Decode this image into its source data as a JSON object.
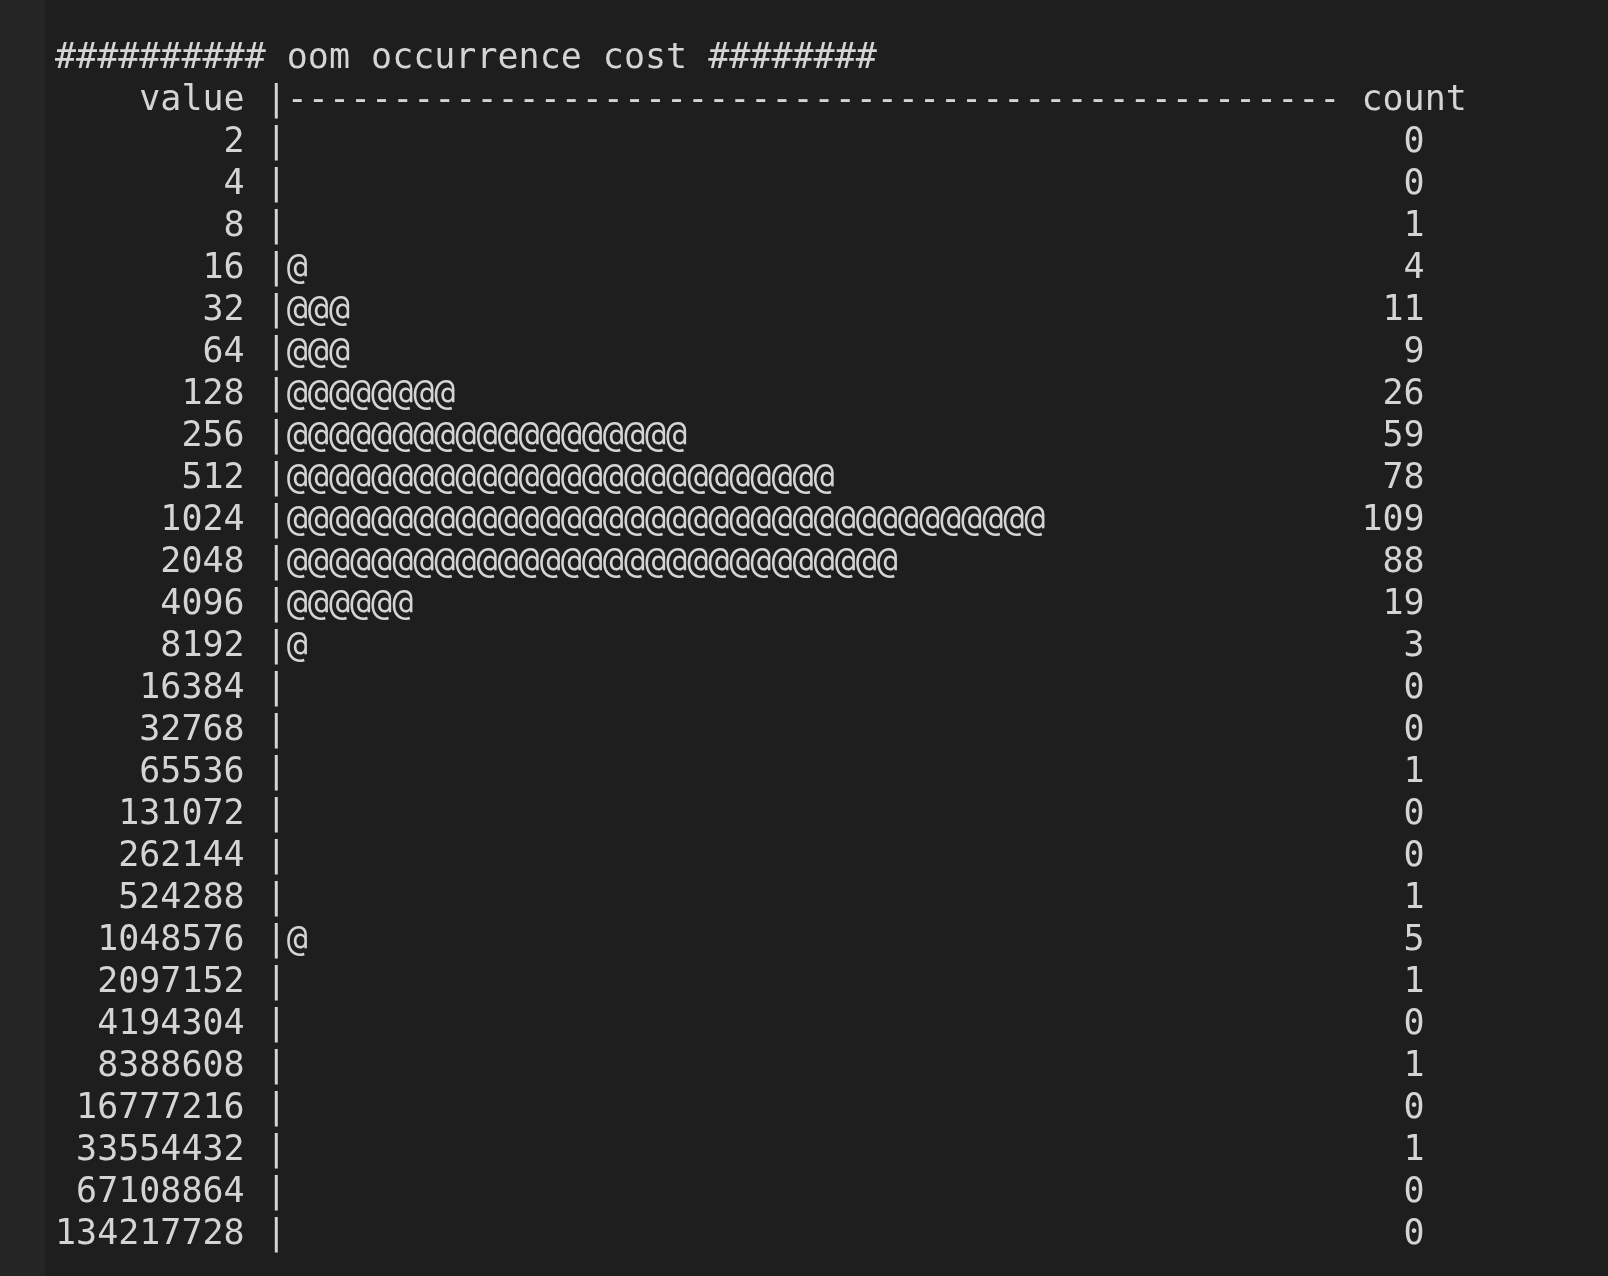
{
  "title": "########## oom occurrence cost ########",
  "header": {
    "value": "value",
    "bar": "|--------------------------------------------------",
    "count": "count"
  },
  "rows": [
    {
      "value": "2",
      "bar": "|",
      "count": "0"
    },
    {
      "value": "4",
      "bar": "|",
      "count": "0"
    },
    {
      "value": "8",
      "bar": "|",
      "count": "1"
    },
    {
      "value": "16",
      "bar": "|@",
      "count": "4"
    },
    {
      "value": "32",
      "bar": "|@@@",
      "count": "11"
    },
    {
      "value": "64",
      "bar": "|@@@",
      "count": "9"
    },
    {
      "value": "128",
      "bar": "|@@@@@@@@",
      "count": "26"
    },
    {
      "value": "256",
      "bar": "|@@@@@@@@@@@@@@@@@@@",
      "count": "59"
    },
    {
      "value": "512",
      "bar": "|@@@@@@@@@@@@@@@@@@@@@@@@@@",
      "count": "78"
    },
    {
      "value": "1024",
      "bar": "|@@@@@@@@@@@@@@@@@@@@@@@@@@@@@@@@@@@@",
      "count": "109"
    },
    {
      "value": "2048",
      "bar": "|@@@@@@@@@@@@@@@@@@@@@@@@@@@@@",
      "count": "88"
    },
    {
      "value": "4096",
      "bar": "|@@@@@@",
      "count": "19"
    },
    {
      "value": "8192",
      "bar": "|@",
      "count": "3"
    },
    {
      "value": "16384",
      "bar": "|",
      "count": "0"
    },
    {
      "value": "32768",
      "bar": "|",
      "count": "0"
    },
    {
      "value": "65536",
      "bar": "|",
      "count": "1"
    },
    {
      "value": "131072",
      "bar": "|",
      "count": "0"
    },
    {
      "value": "262144",
      "bar": "|",
      "count": "0"
    },
    {
      "value": "524288",
      "bar": "|",
      "count": "1"
    },
    {
      "value": "1048576",
      "bar": "|@",
      "count": "5"
    },
    {
      "value": "2097152",
      "bar": "|",
      "count": "1"
    },
    {
      "value": "4194304",
      "bar": "|",
      "count": "0"
    },
    {
      "value": "8388608",
      "bar": "|",
      "count": "1"
    },
    {
      "value": "16777216",
      "bar": "|",
      "count": "0"
    },
    {
      "value": "33554432",
      "bar": "|",
      "count": "1"
    },
    {
      "value": "67108864",
      "bar": "|",
      "count": "0"
    },
    {
      "value": "134217728",
      "bar": "|",
      "count": "0"
    }
  ]
}
